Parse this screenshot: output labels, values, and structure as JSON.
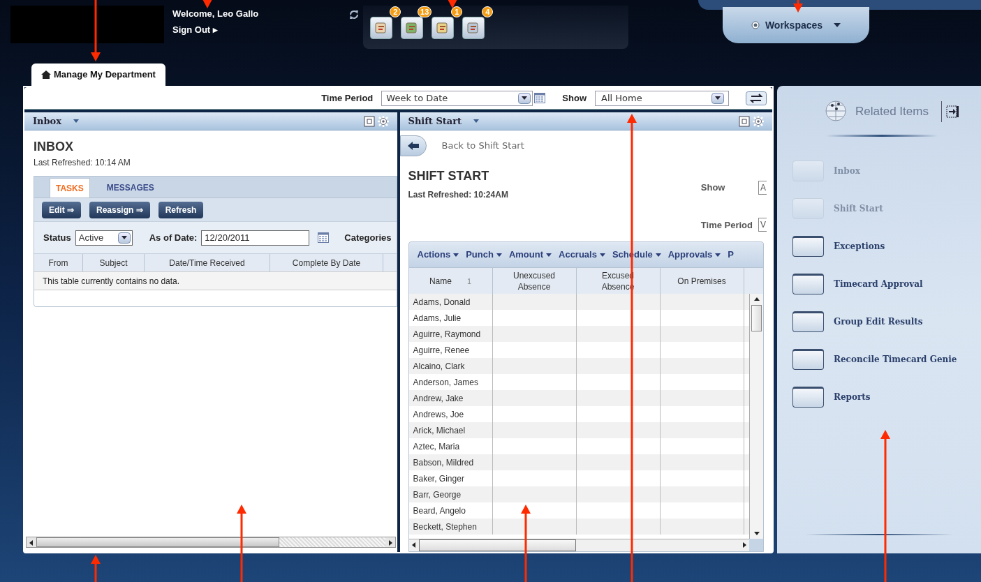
{
  "header": {
    "welcome": "Welcome, Leo Gallo",
    "sign_out": "Sign Out ▸",
    "notifications": [
      {
        "count": "2"
      },
      {
        "count": "13"
      },
      {
        "count": "1"
      },
      {
        "count": "4"
      }
    ],
    "workspaces": "Workspaces"
  },
  "page_tab": {
    "label": "Manage My Department",
    "selected": true
  },
  "toolbar": {
    "time_period_label": "Time Period",
    "time_period_value": "Week to Date",
    "show_label": "Show",
    "show_value": "All Home"
  },
  "inbox": {
    "title": "Inbox",
    "heading": "INBOX",
    "last_refreshed": "Last Refreshed: 10:14 AM",
    "tabs": [
      {
        "label": "TASKS",
        "selected": true
      },
      {
        "label": "MESSAGES",
        "selected": false
      }
    ],
    "buttons": [
      "Edit ⇒",
      "Reassign ⇒",
      "Refresh"
    ],
    "status_label": "Status",
    "status_value": "Active",
    "date_label": "As of Date:",
    "date_value": "12/20/2011",
    "categories_label": "Categories",
    "columns": [
      "From",
      "Subject",
      "Date/Time Received",
      "Complete By Date"
    ],
    "empty_message": "This table currently contains no data."
  },
  "shift_start": {
    "title": "Shift Start",
    "back": "Back to Shift Start",
    "heading": "SHIFT START",
    "last_refreshed": "Last Refreshed: 10:24AM",
    "show_label": "Show",
    "show_value": "A",
    "time_period_label": "Time Period",
    "time_period_value": "V",
    "menus": [
      "Actions",
      "Punch",
      "Amount",
      "Accruals",
      "Schedule",
      "Approvals",
      "P"
    ],
    "columns": [
      "Name",
      "Unexcused Absence",
      "Excused Absence",
      "On Premises"
    ],
    "sort_indicator": "1",
    "rows": [
      "Adams, Donald",
      "Adams, Julie",
      "Aguirre, Raymond",
      "Aguirre, Renee",
      "Alcaino, Clark",
      "Anderson, James",
      "Andrew, Jake",
      "Andrews, Joe",
      "Arick, Michael",
      "Aztec, Maria",
      "Babson, Mildred",
      "Baker, Ginger",
      "Barr, George",
      "Beard, Angelo",
      "Beckett, Stephen"
    ]
  },
  "related_items": {
    "title": "Related Items",
    "items": [
      {
        "label": "Inbox",
        "disabled": true
      },
      {
        "label": "Shift Start",
        "disabled": true
      },
      {
        "label": "Exceptions",
        "disabled": false
      },
      {
        "label": "Timecard Approval",
        "disabled": false
      },
      {
        "label": "Group Edit Results",
        "disabled": false
      },
      {
        "label": "Reconcile Timecard Genie",
        "disabled": false
      },
      {
        "label": "Reports",
        "disabled": false
      }
    ]
  }
}
